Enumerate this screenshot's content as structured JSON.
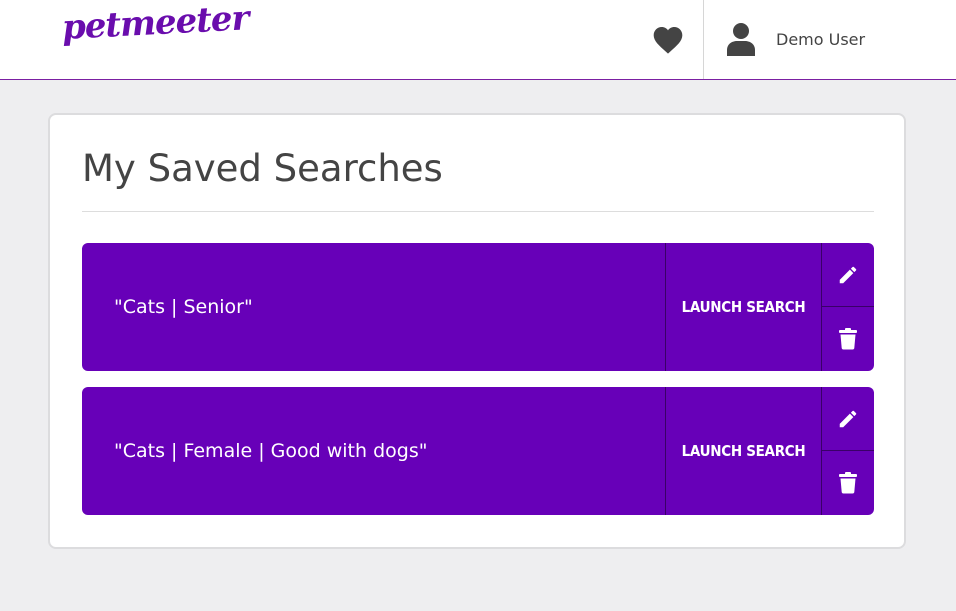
{
  "header": {
    "logo_text": "petmeeter",
    "favorites_icon": "heart-icon",
    "user_icon": "user-icon",
    "user_name": "Demo User"
  },
  "main": {
    "title": "My Saved Searches",
    "saved_searches": [
      {
        "label": "\"Cats | Senior\"",
        "launch_label": "LAUNCH SEARCH",
        "edit_icon": "pencil-icon",
        "delete_icon": "trash-icon"
      },
      {
        "label": "\"Cats | Female | Good with dogs\"",
        "launch_label": "LAUNCH SEARCH",
        "edit_icon": "pencil-icon",
        "delete_icon": "trash-icon"
      }
    ]
  },
  "colors": {
    "brand_purple": "#6a0dad",
    "row_purple": "#6700b8",
    "page_bg": "#eeeef0",
    "icon_gray": "#444444"
  }
}
